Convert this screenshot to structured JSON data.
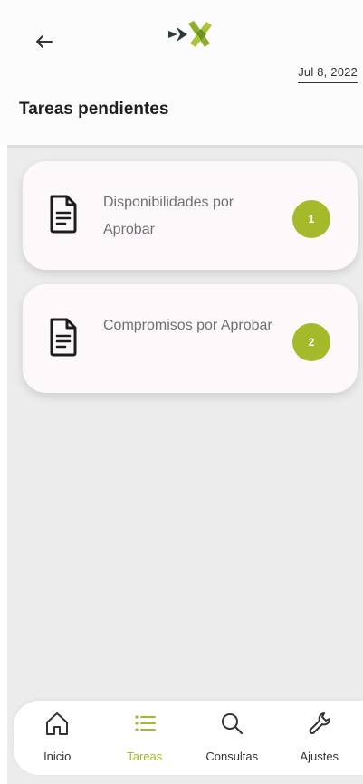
{
  "header": {
    "date": "Jul 8, 2022",
    "title": "Tareas pendientes",
    "back_icon": "arrow-left-icon",
    "logo": "brand-logo"
  },
  "tasks": [
    {
      "label": "Disponibilidades por Aprobar",
      "count": "1",
      "icon": "document-icon"
    },
    {
      "label": "Compromisos por Aprobar",
      "count": "2",
      "icon": "document-icon"
    }
  ],
  "nav": [
    {
      "label": "Inicio",
      "icon": "home-icon",
      "active": false
    },
    {
      "label": "Tareas",
      "icon": "list-icon",
      "active": true
    },
    {
      "label": "Consultas",
      "icon": "search-icon",
      "active": false
    },
    {
      "label": "Ajustes",
      "icon": "wrench-icon",
      "active": false
    }
  ],
  "colors": {
    "accent": "#a5ba2b",
    "brand_dark": "#2e3a3c",
    "background": "#ececec",
    "card": "#fdf9fb"
  }
}
